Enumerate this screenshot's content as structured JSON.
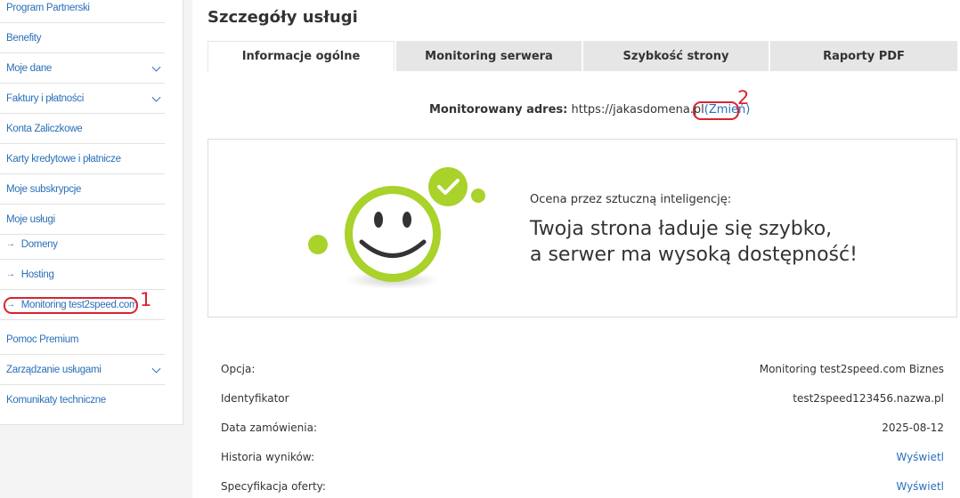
{
  "sidebar": {
    "items": [
      {
        "label": "Program Partnerski"
      },
      {
        "label": "Benefity"
      },
      {
        "label": "Moje dane"
      },
      {
        "label": "Faktury i płatności"
      },
      {
        "label": "Konta Zaliczkowe"
      },
      {
        "label": "Karty kredytowe i płatnicze"
      },
      {
        "label": "Moje subskrypcje"
      },
      {
        "label": "Moje usługi"
      },
      {
        "label": "Domeny"
      },
      {
        "label": "Hosting"
      },
      {
        "label": "Monitoring test2speed.com"
      },
      {
        "label": "Pomoc Premium"
      },
      {
        "label": "Zarządzanie usługami"
      },
      {
        "label": "Komunikaty techniczne"
      }
    ],
    "annotation": "1"
  },
  "main": {
    "title": "Szczegóły usługi",
    "tabs": [
      {
        "label": "Informacje ogólne"
      },
      {
        "label": "Monitoring serwera"
      },
      {
        "label": "Szybkość strony"
      },
      {
        "label": "Raporty PDF"
      }
    ],
    "address": {
      "label": "Monitorowany adres:",
      "url": "https://jakasdomena.pl",
      "change_link": "(Zmień)",
      "annotation": "2"
    },
    "result": {
      "ai_label": "Ocena przez sztuczną inteligencję:",
      "line1": "Twoja strona ładuje się szybko,",
      "line2": "a serwer ma wysoką dostępność!"
    },
    "details": [
      {
        "label": "Opcja:",
        "value": "Monitoring test2speed.com Biznes"
      },
      {
        "label": "Identyfikator",
        "value": "test2speed123456.nazwa.pl"
      },
      {
        "label": "Data zamówienia:",
        "value": "2025-08-12"
      },
      {
        "label": "Historia wyników:",
        "value": "Wyświetl"
      },
      {
        "label": "Specyfikacja oferty:",
        "value": "Wyświetl"
      }
    ]
  },
  "colors": {
    "accent": "#2a6fb8",
    "annotation_red": "#d9232f",
    "smiley_green": "#a9d22a"
  }
}
